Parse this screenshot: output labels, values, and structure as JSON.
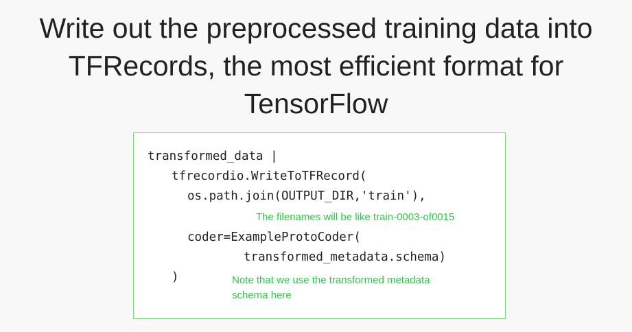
{
  "slide": {
    "title_lines": [
      "Write out the preprocessed training data into",
      "TFRecords, the most efficient format for",
      "TensorFlow"
    ]
  },
  "code": {
    "lines": [
      "transformed_data |",
      "tfrecordio.WriteToTFRecord(",
      "os.path.join(OUTPUT_DIR,'train'),",
      "coder=ExampleProtoCoder(",
      "transformed_metadata.schema)",
      ")"
    ]
  },
  "notes": {
    "filenames": "The filenames will be like train-0003-of0015",
    "schema_line1": "Note that we use the transformed metadata",
    "schema_line2": "schema here"
  },
  "colors": {
    "note_text": "#2ec54a",
    "box_border": "#7ed77e",
    "title_text": "#202124"
  }
}
